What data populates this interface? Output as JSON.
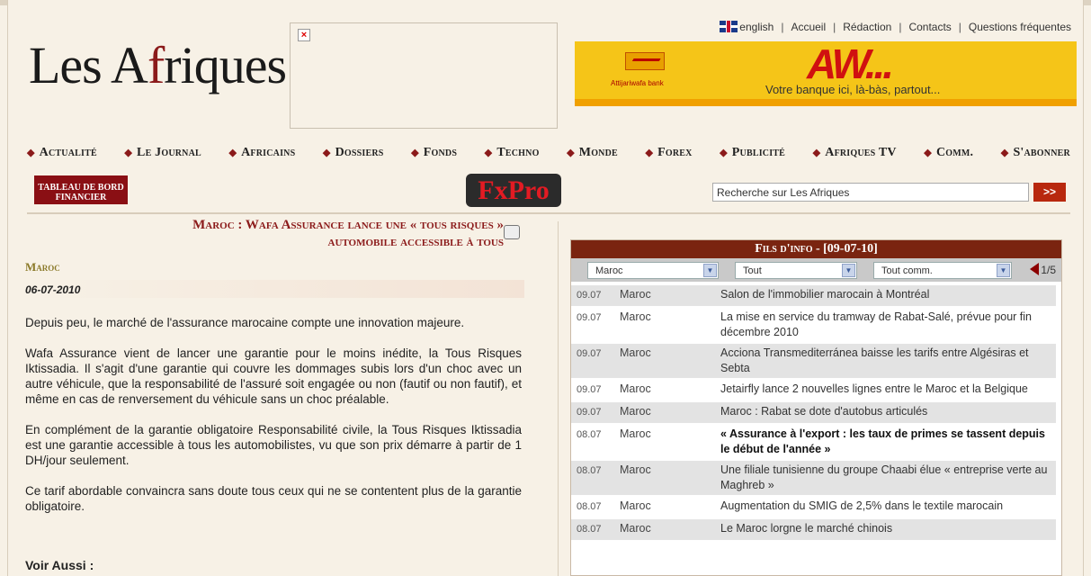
{
  "header": {
    "logo_pre": "Les A",
    "logo_f": "f",
    "logo_post": "riques",
    "toplinks": [
      "english",
      "Accueil",
      "Rédaction",
      "Contacts",
      "Questions fréquentes"
    ]
  },
  "banner": {
    "bank_name": "Attijariwafa bank",
    "slogan_big": "AW",
    "slogan_dots": "...",
    "tagline": "Votre banque ici, là-bàs, partout..."
  },
  "nav": [
    "Actualité",
    "Le Journal",
    "Africains",
    "Dossiers",
    "Fonds",
    "Techno",
    "Monde",
    "Forex",
    "Publicité",
    "Afriques TV",
    "Comm.",
    "S'abonner"
  ],
  "tableau": {
    "line1": "TABLEAU DE BORD",
    "line2": "FINANCIER"
  },
  "fxpro": "FxPro",
  "search": {
    "value": "Recherche sur Les Afriques",
    "button": ">>"
  },
  "article": {
    "title_line1": "Maroc : Wafa Assurance lance une « tous risques »",
    "title_line2": "automobile accessible à tous",
    "category": "Maroc",
    "date": "06-07-2010",
    "paragraphs": [
      "Depuis peu, le marché de l'assurance marocaine compte une innovation majeure.",
      "Wafa Assurance vient de lancer une garantie pour le moins inédite, la Tous Risques Iktissadia. Il s'agit d'une garantie qui couvre les dommages subis lors d'un choc avec un autre véhicule, que la responsabilité de l'assuré soit engagée ou non (fautif ou non fautif), et même en cas de renversement du véhicule sans un choc préalable.",
      "En complément de la garantie obligatoire Responsabilité civile, la Tous Risques Iktissadia est une garantie accessible à tous les automobilistes, vu que son prix démarre à partir de 1 DH/jour seulement.",
      "Ce tarif abordable convaincra sans doute tous ceux qui ne se contentent plus de la garantie obligatoire."
    ],
    "voir_aussi": "Voir Aussi :"
  },
  "fils": {
    "title": "Fils d'info - [09-07-10]",
    "filters": [
      "Maroc",
      "Tout",
      "Tout comm."
    ],
    "pager": "1/5",
    "items": [
      {
        "date": "09.07",
        "country": "Maroc",
        "text": "Salon de l'immobilier marocain à Montréal",
        "bold": false
      },
      {
        "date": "09.07",
        "country": "Maroc",
        "text": "La mise en service du tramway de Rabat-Salé, prévue pour fin décembre 2010",
        "bold": false
      },
      {
        "date": "09.07",
        "country": "Maroc",
        "text": "Acciona Transmediterránea baisse les tarifs entre Algésiras et Sebta",
        "bold": false
      },
      {
        "date": "09.07",
        "country": "Maroc",
        "text": "Jetairfly lance 2 nouvelles lignes entre le Maroc et la Belgique",
        "bold": false
      },
      {
        "date": "09.07",
        "country": "Maroc",
        "text": "Maroc : Rabat se dote d'autobus articulés",
        "bold": false
      },
      {
        "date": "08.07",
        "country": "Maroc",
        "text": "« Assurance à l'export : les taux de primes se tassent depuis le début de l'année »",
        "bold": true
      },
      {
        "date": "08.07",
        "country": "Maroc",
        "text": "Une filiale tunisienne du groupe Chaabi élue « entreprise verte au Maghreb »",
        "bold": false
      },
      {
        "date": "08.07",
        "country": "Maroc",
        "text": "Augmentation du SMIG de 2,5% dans le textile marocain",
        "bold": false
      },
      {
        "date": "08.07",
        "country": "Maroc",
        "text": "Le Maroc lorgne le marché chinois",
        "bold": false
      }
    ]
  }
}
